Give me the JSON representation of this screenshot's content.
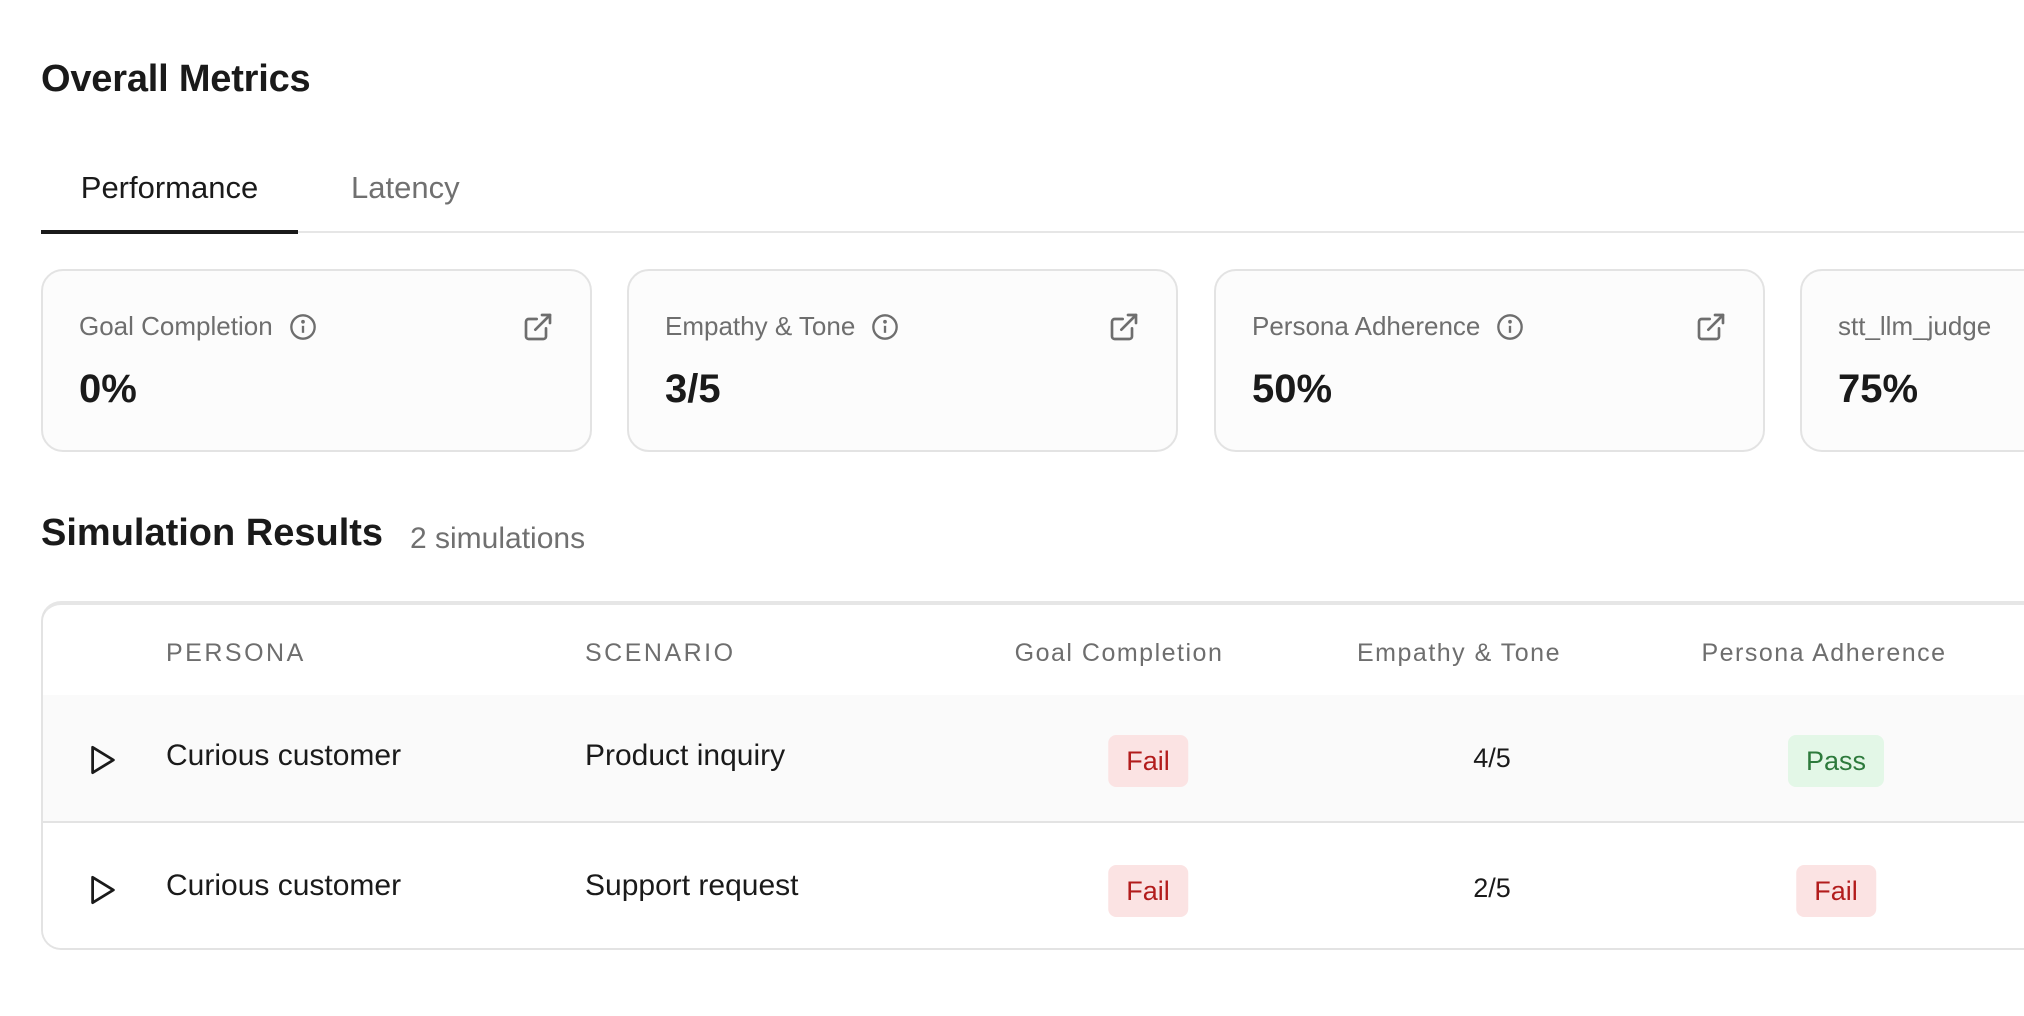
{
  "metrics": {
    "title": "Overall Metrics",
    "tabs": [
      {
        "label": "Performance",
        "active": true
      },
      {
        "label": "Latency",
        "active": false
      }
    ],
    "cards": [
      {
        "label": "Goal Completion",
        "value": "0%",
        "has_info": true,
        "has_link": true
      },
      {
        "label": "Empathy & Tone",
        "value": "3/5",
        "has_info": true,
        "has_link": true
      },
      {
        "label": "Persona Adherence",
        "value": "50%",
        "has_info": true,
        "has_link": true
      },
      {
        "label": "stt_llm_judge",
        "value": "75%",
        "has_info": false,
        "has_link": false
      }
    ]
  },
  "simulations": {
    "title": "Simulation Results",
    "count_label": "2 simulations",
    "columns": [
      "PERSONA",
      "SCENARIO",
      "Goal Completion",
      "Empathy & Tone",
      "Persona Adherence"
    ],
    "rows": [
      {
        "persona": "Curious customer",
        "scenario": "Product inquiry",
        "goal_completion": "Fail",
        "empathy_tone": "4/5",
        "persona_adherence": "Pass"
      },
      {
        "persona": "Curious customer",
        "scenario": "Support request",
        "goal_completion": "Fail",
        "empathy_tone": "2/5",
        "persona_adherence": "Fail"
      }
    ]
  },
  "colors": {
    "fail_bg": "#fbe3e3",
    "fail_text": "#b21c1c",
    "pass_bg": "#e3f7e7",
    "pass_text": "#2d7a3c"
  },
  "icons": {
    "info": "info-circle-icon",
    "external_link": "external-link-icon",
    "play": "play-icon"
  }
}
